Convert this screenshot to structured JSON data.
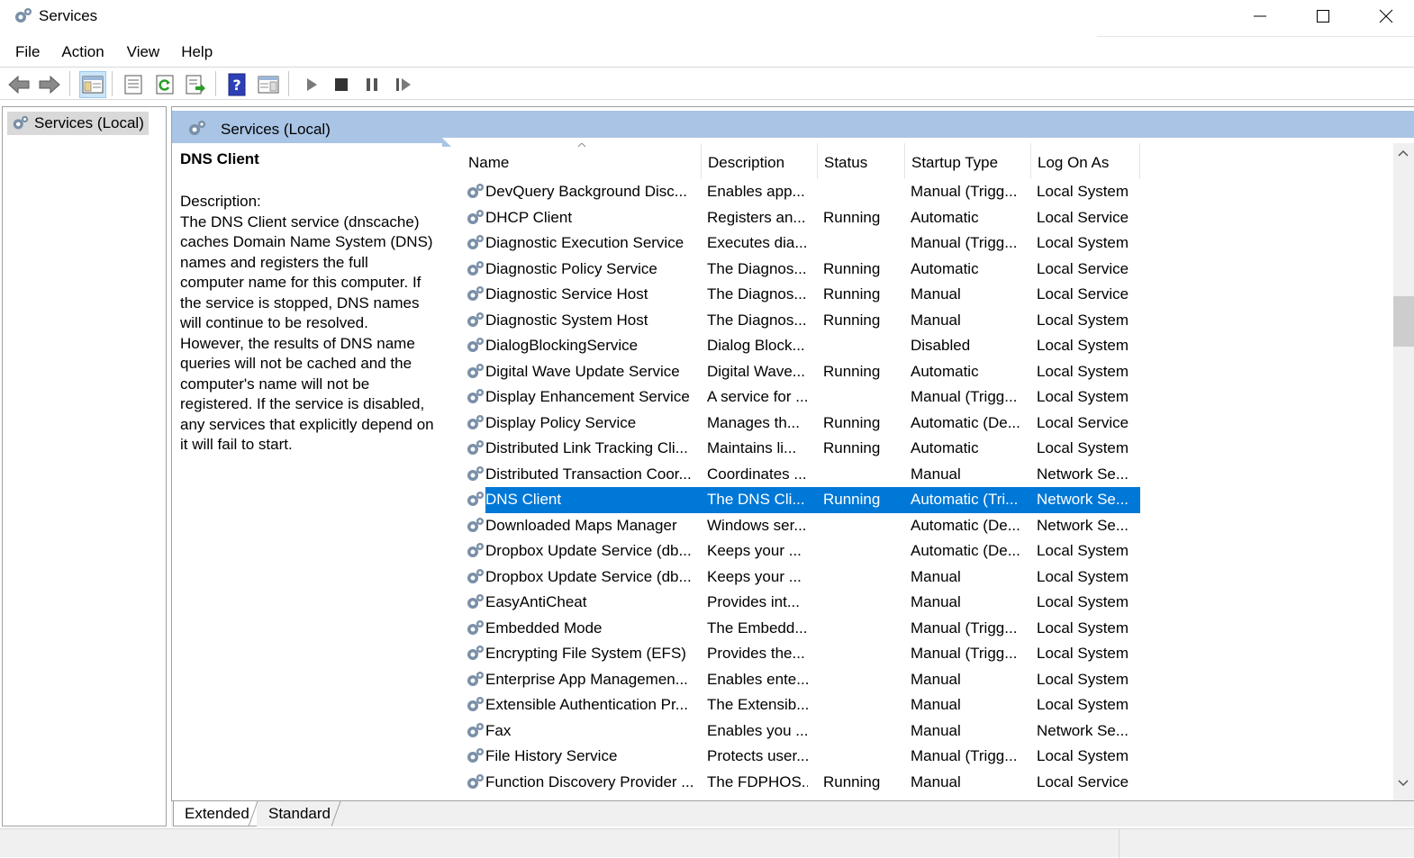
{
  "window": {
    "title": "Services"
  },
  "menu": [
    "File",
    "Action",
    "View",
    "Help"
  ],
  "tree": {
    "root": "Services (Local)"
  },
  "panel": {
    "title": "Services (Local)"
  },
  "details": {
    "service_name": "DNS Client",
    "description_label": "Description:",
    "description_lines": [
      "The DNS Client service (dnscache)",
      "caches Domain Name System (DNS)",
      "names and registers the full",
      "computer name for this computer. If",
      "the service is stopped, DNS names",
      "will continue to be resolved.",
      "However, the results of DNS name",
      "queries will not be cached and the",
      "computer's name will not be",
      "registered. If the service is disabled,",
      "any services that explicitly depend on",
      "it will fail to start."
    ]
  },
  "columns": [
    "Name",
    "Description",
    "Status",
    "Startup Type",
    "Log On As"
  ],
  "rows": [
    [
      "DevQuery Background Disc...",
      "Enables app...",
      "",
      "Manual (Trigg...",
      "Local System"
    ],
    [
      "DHCP Client",
      "Registers an...",
      "Running",
      "Automatic",
      "Local Service"
    ],
    [
      "Diagnostic Execution Service",
      "Executes dia...",
      "",
      "Manual (Trigg...",
      "Local System"
    ],
    [
      "Diagnostic Policy Service",
      "The Diagnos...",
      "Running",
      "Automatic",
      "Local Service"
    ],
    [
      "Diagnostic Service Host",
      "The Diagnos...",
      "Running",
      "Manual",
      "Local Service"
    ],
    [
      "Diagnostic System Host",
      "The Diagnos...",
      "Running",
      "Manual",
      "Local System"
    ],
    [
      "DialogBlockingService",
      "Dialog Block...",
      "",
      "Disabled",
      "Local System"
    ],
    [
      "Digital Wave Update Service",
      "Digital Wave...",
      "Running",
      "Automatic",
      "Local System"
    ],
    [
      "Display Enhancement Service",
      "A service for ...",
      "",
      "Manual (Trigg...",
      "Local System"
    ],
    [
      "Display Policy Service",
      "Manages th...",
      "Running",
      "Automatic (De...",
      "Local Service"
    ],
    [
      "Distributed Link Tracking Cli...",
      "Maintains li...",
      "Running",
      "Automatic",
      "Local System"
    ],
    [
      "Distributed Transaction Coor...",
      "Coordinates ...",
      "",
      "Manual",
      "Network Se..."
    ],
    [
      "DNS Client",
      "The DNS Cli...",
      "Running",
      "Automatic (Tri...",
      "Network Se..."
    ],
    [
      "Downloaded Maps Manager",
      "Windows ser...",
      "",
      "Automatic (De...",
      "Network Se..."
    ],
    [
      "Dropbox Update Service (db...",
      "Keeps your ...",
      "",
      "Automatic (De...",
      "Local System"
    ],
    [
      "Dropbox Update Service (db...",
      "Keeps your ...",
      "",
      "Manual",
      "Local System"
    ],
    [
      "EasyAntiCheat",
      "Provides int...",
      "",
      "Manual",
      "Local System"
    ],
    [
      "Embedded Mode",
      "The Embedd...",
      "",
      "Manual (Trigg...",
      "Local System"
    ],
    [
      "Encrypting File System (EFS)",
      "Provides the...",
      "",
      "Manual (Trigg...",
      "Local System"
    ],
    [
      "Enterprise App Managemen...",
      "Enables ente...",
      "",
      "Manual",
      "Local System"
    ],
    [
      "Extensible Authentication Pr...",
      "The Extensib...",
      "",
      "Manual",
      "Local System"
    ],
    [
      "Fax",
      "Enables you ...",
      "",
      "Manual",
      "Network Se..."
    ],
    [
      "File History Service",
      "Protects user...",
      "",
      "Manual (Trigg...",
      "Local System"
    ],
    [
      "Function Discovery Provider ...",
      "The FDPHOS...",
      "Running",
      "Manual",
      "Local Service"
    ]
  ],
  "selected_row": "DNS Client",
  "tabs": [
    "Extended",
    "Standard"
  ],
  "colors": {
    "selection": "#0078d7",
    "header": "#a9c4e4"
  }
}
